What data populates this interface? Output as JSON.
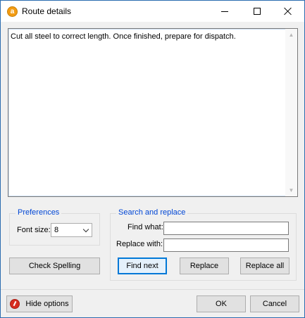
{
  "window": {
    "title": "Route details",
    "app_icon_letter": "a"
  },
  "editor": {
    "text": "Cut all steel to correct length. Once finished, prepare for dispatch."
  },
  "preferences": {
    "group_label": "Preferences",
    "font_size_label": "Font size:",
    "font_size_value": "8"
  },
  "search_replace": {
    "group_label": "Search and replace",
    "find_what_label": "Find what:",
    "find_what_value": "",
    "replace_with_label": "Replace with:",
    "replace_with_value": "",
    "find_next_label": "Find next",
    "replace_label": "Replace",
    "replace_all_label": "Replace all"
  },
  "check_spelling_label": "Check Spelling",
  "footer": {
    "hide_options_label": "Hide options",
    "ok_label": "OK",
    "cancel_label": "Cancel"
  },
  "icons": {
    "app": "app-logo-icon",
    "minimize": "minimize-icon",
    "maximize": "maximize-icon",
    "close": "close-icon",
    "hide_options": "hide-options-icon",
    "dropdown": "chevron-down-icon"
  },
  "colors": {
    "accent": "#0078d7",
    "group_label": "#0046d5",
    "window_bg": "#f0f0f0"
  }
}
